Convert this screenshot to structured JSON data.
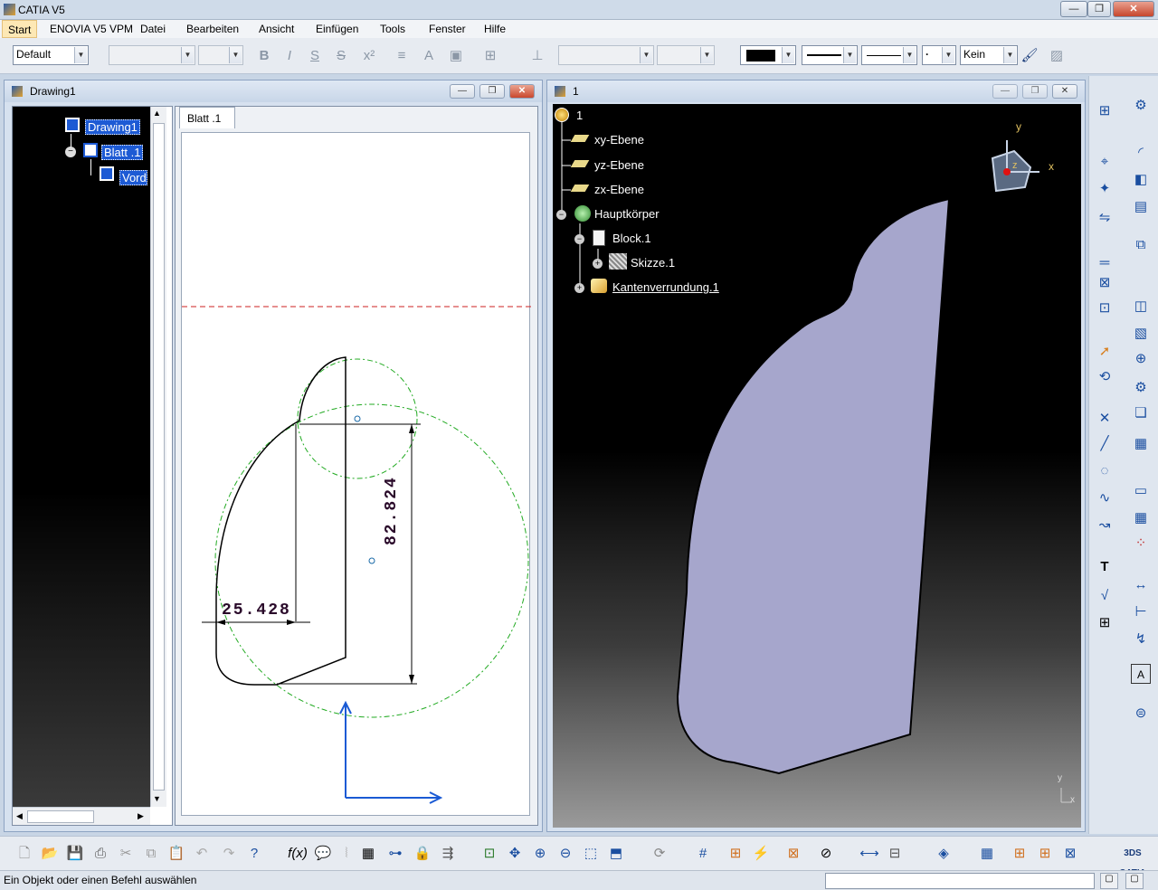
{
  "app": {
    "title": "CATIA V5"
  },
  "menu": [
    "Start",
    "ENOVIA V5 VPM",
    "Datei",
    "Bearbeiten",
    "Ansicht",
    "Einfügen",
    "Tools",
    "Fenster",
    "Hilfe"
  ],
  "toolbar": {
    "style_combo": "Default",
    "linetype_combo": "Kein",
    "fill_color": "#000000"
  },
  "drawing_window": {
    "title": "Drawing1",
    "tree": {
      "root": "Drawing1",
      "sheet": "Blatt .1",
      "view": "Vord"
    },
    "tab": "Blatt .1",
    "dimensions": {
      "horizontal": "25.428",
      "vertical": "82.824"
    }
  },
  "part_window": {
    "title": "1",
    "tree": {
      "root": "1",
      "planes": [
        "xy-Ebene",
        "yz-Ebene",
        "zx-Ebene"
      ],
      "body": "Hauptkörper",
      "block": "Block.1",
      "sketch": "Skizze.1",
      "fillet": "Kantenverrundung.1"
    },
    "compass": {
      "x": "x",
      "y": "y",
      "z": "z"
    },
    "axis_x": "x",
    "axis_y": "y"
  },
  "status": {
    "message": "Ein Objekt oder einen Befehl auswählen"
  },
  "colors": {
    "part_fill": "#a6a6cc",
    "selection": "#1d5ad4",
    "dim_text": "#2a0a2a",
    "construction": "#22aa22"
  }
}
